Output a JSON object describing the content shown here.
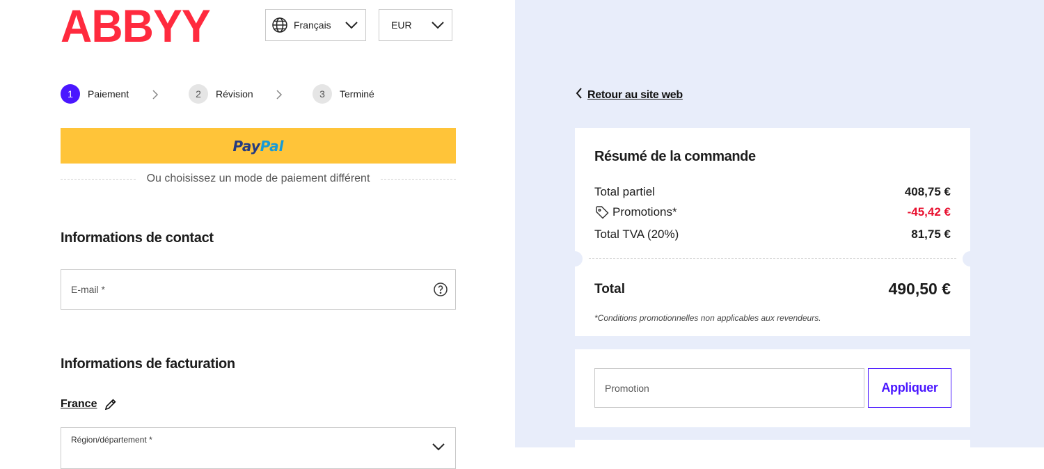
{
  "brand": {
    "logo": "ABBYY",
    "color": "#ff2a3e"
  },
  "header": {
    "language": "Français",
    "currency": "EUR"
  },
  "steps": [
    {
      "num": "1",
      "label": "Paiement",
      "active": true
    },
    {
      "num": "2",
      "label": "Révision",
      "active": false
    },
    {
      "num": "3",
      "label": "Terminé",
      "active": false
    }
  ],
  "paypal": {
    "part1": "Pay",
    "part2": "Pal"
  },
  "divider_text": "Ou choisissez un mode de paiement différent",
  "contact": {
    "heading": "Informations de contact",
    "email_placeholder": "E-mail *"
  },
  "billing": {
    "heading": "Informations de facturation",
    "country": "France",
    "region_label": "Région/département *"
  },
  "back_link": "Retour au site web",
  "summary": {
    "title": "Résumé de la commande",
    "subtotal_label": "Total partiel",
    "subtotal_value": "408,75 €",
    "promotions_label": "Promotions*",
    "promotions_value": "-45,42 €",
    "vat_label": "Total TVA (20%)",
    "vat_value": "81,75 €",
    "total_label": "Total",
    "total_value": "490,50 €",
    "conditions": "*Conditions promotionnelles non applicables aux revendeurs."
  },
  "promo": {
    "placeholder": "Promotion",
    "apply_label": "Appliquer"
  },
  "colors": {
    "accent": "#4a17ff",
    "negative": "#e8102f",
    "paypal_bg": "#ffc439",
    "panel_bg": "#e8edfa"
  }
}
